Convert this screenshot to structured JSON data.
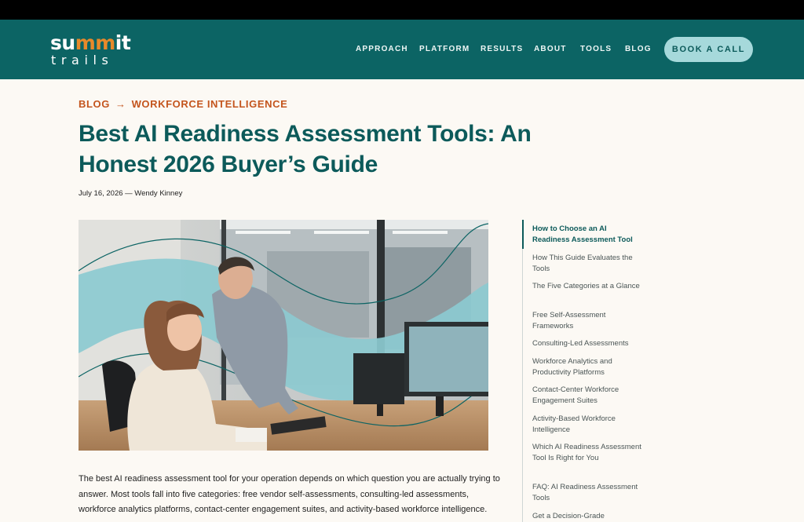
{
  "brand": {
    "line1_a": "su",
    "line1_b": "mm",
    "line1_c": "it",
    "line2": "trails"
  },
  "nav": {
    "items": [
      "APPROACH",
      "PLATFORM",
      "RESULTS",
      "ABOUT",
      "TOOLS",
      "BLOG"
    ],
    "cta": "BOOK A CALL"
  },
  "breadcrumb": {
    "root": "BLOG",
    "separator": "→",
    "section": "WORKFORCE INTELLIGENCE"
  },
  "article": {
    "title": "Best AI Readiness Assessment Tools: An Honest 2026 Buyer’s Guide",
    "meta": "July 16, 2026 — Wendy Kinney",
    "intro": "The best AI readiness assessment tool for your operation depends on which question you are actually trying to answer. Most tools fall into five categories: free vendor self-assessments, consulting-led assessments, workforce analytics platforms, contact-center engagement suites, and activity-based workforce intelligence."
  },
  "toc": {
    "items": [
      "How to Choose an AI Readiness Assessment Tool",
      "How This Guide Evaluates the Tools",
      "The Five Categories at a Glance",
      "Free Self-Assessment Frameworks",
      "Consulting-Led Assessments",
      "Workforce Analytics and Productivity Platforms",
      "Contact-Center Workforce Engagement Suites",
      "Activity-Based Workforce Intelligence",
      "Which AI Readiness Assessment Tool Is Right for You",
      "FAQ: AI Readiness Assessment Tools",
      "Get a Decision-Grade"
    ],
    "active_index": 0
  },
  "colors": {
    "brand_teal": "#0c6464",
    "accent_orange": "#c4551e",
    "cta_bg": "#a6d9db",
    "page_bg": "#fcf9f4"
  }
}
